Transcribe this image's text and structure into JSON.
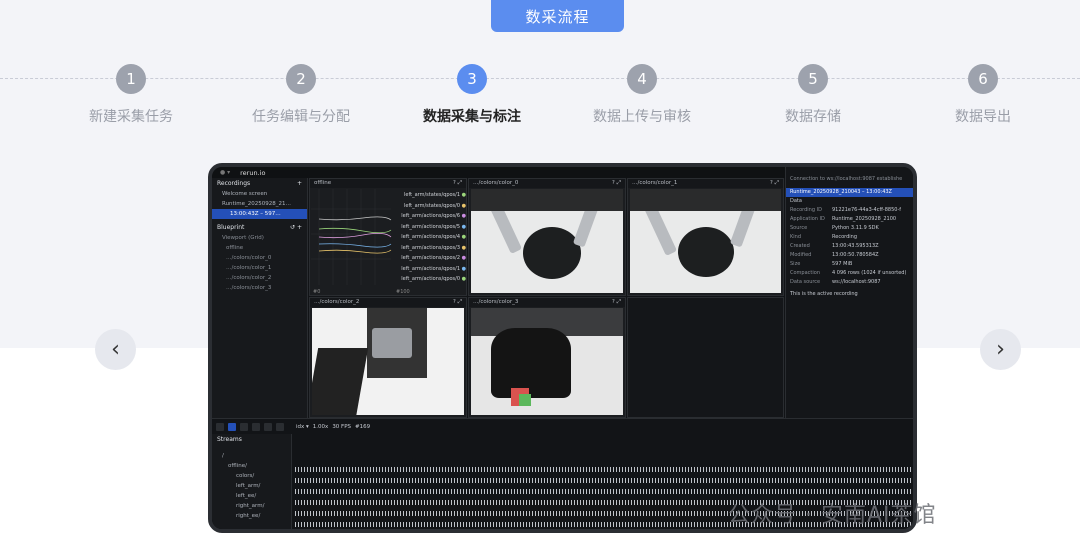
{
  "header": {
    "title": "数采流程"
  },
  "steps": [
    {
      "num": "1",
      "label": "新建采集任务"
    },
    {
      "num": "2",
      "label": "任务编辑与分配"
    },
    {
      "num": "3",
      "label": "数据采集与标注"
    },
    {
      "num": "4",
      "label": "数据上传与审核"
    },
    {
      "num": "5",
      "label": "数据存储"
    },
    {
      "num": "6",
      "label": "数据导出"
    }
  ],
  "active_step": 3,
  "nav": {
    "prev": "‹",
    "next": "›"
  },
  "app": {
    "title": "rerun.io",
    "recordings_label": "Recordings",
    "recordings": [
      "Welcome screen",
      "Runtime_20250928_21…",
      "13:00:43Z – 597…"
    ],
    "blueprint_label": "Blueprint",
    "blueprint_items": [
      "Viewport (Grid)",
      "offline",
      "…/colors/color_0",
      "…/colors/color_1",
      "…/colors/color_2",
      "…/colors/color_3"
    ],
    "views": {
      "plot_title": "offline",
      "plot_series": [
        "left_arm/states/qpos/1",
        "left_arm/states/qpos/0",
        "left_arm/actions/qpos/6",
        "left_arm/actions/qpos/5",
        "left_arm/actions/qpos/4",
        "left_arm/actions/qpos/3",
        "left_arm/actions/qpos/2",
        "left_arm/actions/qpos/1",
        "left_arm/actions/qpos/0"
      ],
      "plot_x0": "#0",
      "plot_x1": "#100",
      "cam0": "…/colors/color_0",
      "cam1": "…/colors/color_1",
      "cam2": "…/colors/color_2",
      "cam3": "…/colors/color_3"
    },
    "right": {
      "connection": "Connection to ws://localhost:9087 establishe",
      "selected": "Runtime_20250928_210043 – 13:00:43Z",
      "data_label": "Data",
      "rows": [
        {
          "k": "Recording ID",
          "v": "91221e76-44a3-4cff-8850-f"
        },
        {
          "k": "Application ID",
          "v": "Runtime_20250928_2100"
        },
        {
          "k": "Source",
          "v": "Python 3.11.9 SDK"
        },
        {
          "k": "Kind",
          "v": "Recording"
        },
        {
          "k": "Created",
          "v": "13:00:43.595313Z"
        },
        {
          "k": "Modified",
          "v": "13:00:50.780584Z"
        },
        {
          "k": "Size",
          "v": "597 MiB"
        },
        {
          "k": "Compaction",
          "v": "4 096 rows (1024 if unsorted)"
        },
        {
          "k": "Data source",
          "v": "ws://localhost:9087"
        }
      ],
      "active_note": "This is the active recording"
    },
    "timeline": {
      "timeline_name": "idx ▾",
      "speed": "1.00x",
      "fps": "30 FPS",
      "frame": "#169",
      "streams_label": "Streams",
      "stream_items": [
        "/",
        "offline/",
        "colors/",
        "left_arm/",
        "left_ee/",
        "right_arm/",
        "right_ee/"
      ]
    }
  },
  "watermark": "公众号 · 安南AI茶馆"
}
